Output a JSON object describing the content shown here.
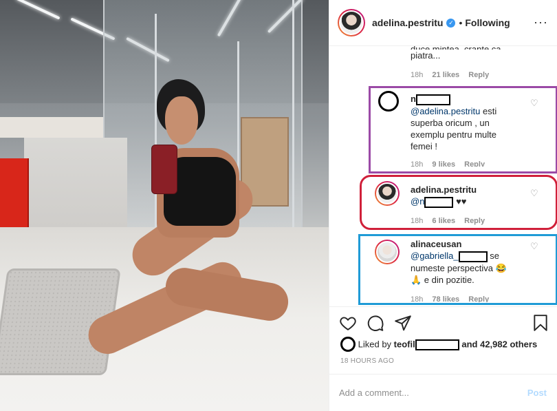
{
  "header": {
    "username": "adelina.pestritu",
    "separator": "•",
    "follow_state": "Following",
    "more": "···"
  },
  "comments": {
    "c1": {
      "text_tail": "piatra...",
      "time": "18h",
      "likes": "21 likes",
      "reply": "Reply"
    },
    "c2": {
      "user_prefix": "n",
      "mention": "@adelina.pestritu",
      "text_lines": [
        "esti",
        "superba oricum , un",
        "exemplu pentru multe",
        "femei !"
      ],
      "time": "18h",
      "likes": "9 likes",
      "reply": "Reply"
    },
    "c3": {
      "username": "adelina.pestritu",
      "mention_prefix": "@n",
      "hearts": "♥♥",
      "time": "18h",
      "likes": "6 likes",
      "reply": "Reply"
    },
    "c4": {
      "username": "alinaceusan",
      "mention": "@gabriella_",
      "text_lines": [
        "se",
        "numeste perspectiva 😂",
        "🙏 e din pozitie."
      ],
      "time": "18h",
      "likes": "78 likes",
      "reply": "Reply"
    }
  },
  "likes": {
    "prefix": "Liked by",
    "user_prefix": "teofil",
    "suffix": "and 42,982 others"
  },
  "timestamp": "18 HOURS AGO",
  "add_comment": {
    "placeholder": "Add a comment...",
    "post": "Post"
  },
  "icons": {
    "like": "heart-icon",
    "comment": "comment-icon",
    "share": "share-icon",
    "save": "bookmark-icon"
  },
  "colors": {
    "purple_box": "#9b4aa6",
    "red_box": "#d0203a",
    "blue_box": "#1f9bd6",
    "verified": "#3897f0"
  }
}
